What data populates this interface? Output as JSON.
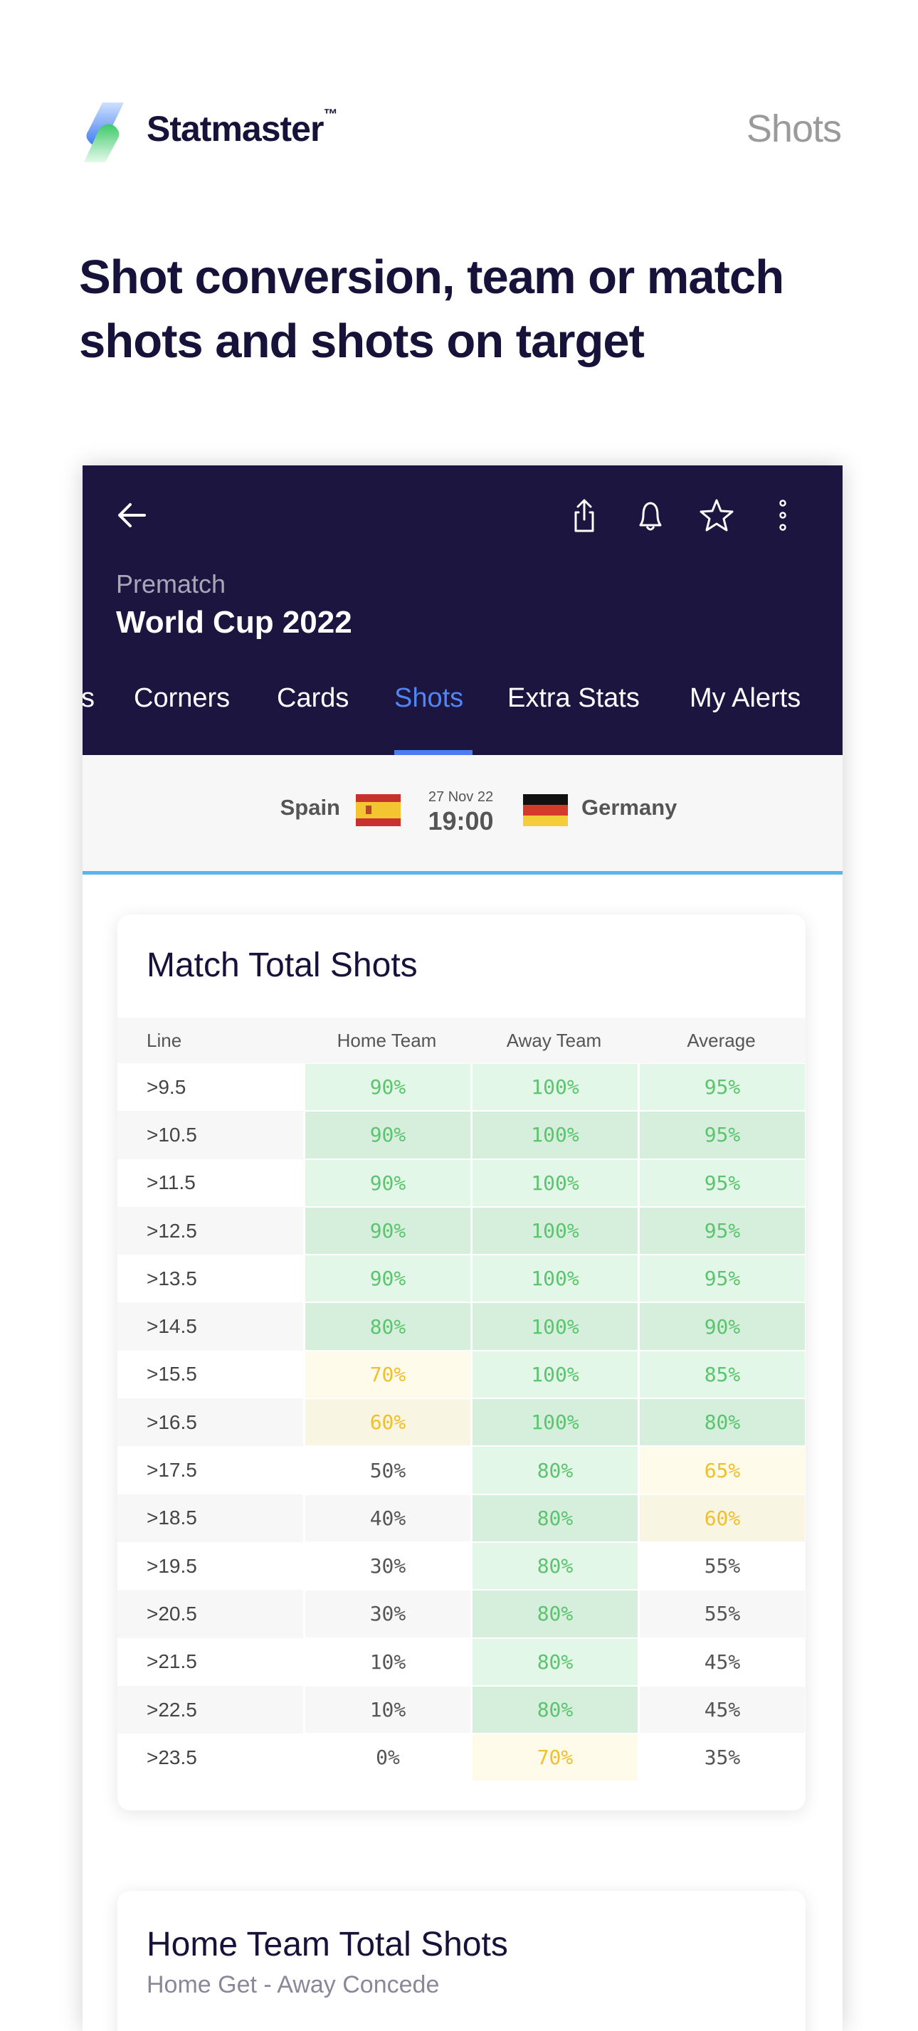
{
  "header": {
    "brand": "Statmaster",
    "trademark": "™",
    "section_label": "Shots"
  },
  "headline": "Shot conversion, team or match shots and shots on target",
  "app": {
    "icons": [
      "back-arrow-icon",
      "share-icon",
      "bell-icon",
      "star-icon",
      "more-vertical-icon"
    ],
    "subtitle": "Prematch",
    "competition": "World Cup 2022",
    "tabs": [
      {
        "label": "s",
        "active": false
      },
      {
        "label": "Corners",
        "active": false
      },
      {
        "label": "Cards",
        "active": false
      },
      {
        "label": "Shots",
        "active": true
      },
      {
        "label": "Extra Stats",
        "active": false
      },
      {
        "label": "My Alerts",
        "active": false
      }
    ],
    "match": {
      "home": "Spain",
      "away": "Germany",
      "date": "27 Nov 22",
      "time": "19:00"
    }
  },
  "colors": {
    "header_bg": "#1b1540",
    "accent": "#4a7ef0",
    "green": "#5cc46e",
    "yellow": "#f0bf2e"
  },
  "match_total_shots": {
    "title": "Match Total Shots",
    "columns": [
      "Line",
      "Home Team",
      "Away Team",
      "Average"
    ],
    "rows": [
      [
        ">9.5",
        "90%",
        "100%",
        "95%"
      ],
      [
        ">10.5",
        "90%",
        "100%",
        "95%"
      ],
      [
        ">11.5",
        "90%",
        "100%",
        "95%"
      ],
      [
        ">12.5",
        "90%",
        "100%",
        "95%"
      ],
      [
        ">13.5",
        "90%",
        "100%",
        "95%"
      ],
      [
        ">14.5",
        "80%",
        "100%",
        "90%"
      ],
      [
        ">15.5",
        "70%",
        "100%",
        "85%"
      ],
      [
        ">16.5",
        "60%",
        "100%",
        "80%"
      ],
      [
        ">17.5",
        "50%",
        "80%",
        "65%"
      ],
      [
        ">18.5",
        "40%",
        "80%",
        "60%"
      ],
      [
        ">19.5",
        "30%",
        "80%",
        "55%"
      ],
      [
        ">20.5",
        "30%",
        "80%",
        "55%"
      ],
      [
        ">21.5",
        "10%",
        "80%",
        "45%"
      ],
      [
        ">22.5",
        "10%",
        "80%",
        "45%"
      ],
      [
        ">23.5",
        "0%",
        "70%",
        "35%"
      ]
    ]
  },
  "home_team_total_shots": {
    "title": "Home Team Total Shots",
    "subtitle": "Home Get - Away Concede"
  }
}
